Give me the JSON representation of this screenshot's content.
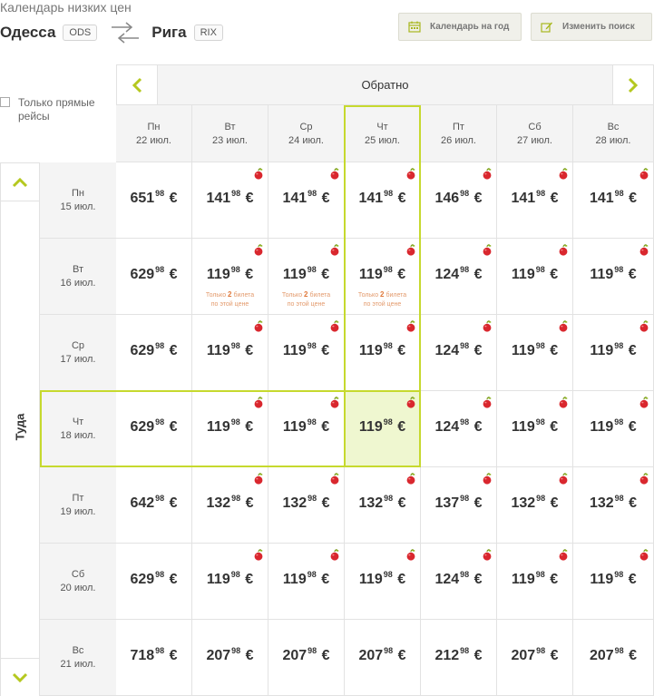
{
  "page_title": "Календарь низких цен",
  "route": {
    "from_city": "Одесса",
    "from_code": "ODS",
    "to_city": "Рига",
    "to_code": "RIX"
  },
  "toolbar": {
    "year_calendar_label": "Календарь на год",
    "change_search_label": "Изменить поиск"
  },
  "filters": {
    "direct_only_label": "Только прямые рейсы",
    "direct_only_checked": false
  },
  "return_nav": {
    "label": "Обратно"
  },
  "depart_nav": {
    "label": "Туда"
  },
  "icons": {
    "prev": "chevron-left-icon",
    "next": "chevron-right-icon",
    "up": "chevron-up-icon",
    "down": "chevron-down-icon",
    "swap": "swap-arrows-icon",
    "calendar": "calendar-icon",
    "edit": "edit-icon",
    "deal": "apple-deal-icon"
  },
  "colors": {
    "accent": "#c6d92e",
    "selected_bg": "#eff7d0",
    "note": "#e0783a",
    "deal": "#d9272e"
  },
  "return_dates": [
    {
      "day": "Пн",
      "date": "22 июл."
    },
    {
      "day": "Вт",
      "date": "23 июл."
    },
    {
      "day": "Ср",
      "date": "24 июл."
    },
    {
      "day": "Чт",
      "date": "25 июл."
    },
    {
      "day": "Пт",
      "date": "26 июл."
    },
    {
      "day": "Сб",
      "date": "27 июл."
    },
    {
      "day": "Вс",
      "date": "28 июл."
    }
  ],
  "depart_dates": [
    {
      "day": "Пн",
      "date": "15 июл."
    },
    {
      "day": "Вт",
      "date": "16 июл."
    },
    {
      "day": "Ср",
      "date": "17 июл."
    },
    {
      "day": "Чт",
      "date": "18 июл."
    },
    {
      "day": "Пт",
      "date": "19 июл."
    },
    {
      "day": "Сб",
      "date": "20 июл."
    },
    {
      "day": "Вс",
      "date": "21 июл."
    }
  ],
  "selected": {
    "depart_index": 3,
    "return_index": 3
  },
  "prices": [
    [
      {
        "main": "651",
        "cents": "98",
        "cur": "€",
        "deal": false
      },
      {
        "main": "141",
        "cents": "98",
        "cur": "€",
        "deal": true
      },
      {
        "main": "141",
        "cents": "98",
        "cur": "€",
        "deal": true
      },
      {
        "main": "141",
        "cents": "98",
        "cur": "€",
        "deal": true
      },
      {
        "main": "146",
        "cents": "98",
        "cur": "€",
        "deal": true
      },
      {
        "main": "141",
        "cents": "98",
        "cur": "€",
        "deal": true
      },
      {
        "main": "141",
        "cents": "98",
        "cur": "€",
        "deal": true
      }
    ],
    [
      {
        "main": "629",
        "cents": "98",
        "cur": "€",
        "deal": false
      },
      {
        "main": "119",
        "cents": "98",
        "cur": "€",
        "deal": true,
        "note": [
          "Только ",
          "2",
          " билета",
          "по этой цене"
        ]
      },
      {
        "main": "119",
        "cents": "98",
        "cur": "€",
        "deal": true,
        "note": [
          "Только ",
          "2",
          " билета",
          "по этой цене"
        ]
      },
      {
        "main": "119",
        "cents": "98",
        "cur": "€",
        "deal": true,
        "note": [
          "Только ",
          "2",
          " билета",
          "по этой цене"
        ]
      },
      {
        "main": "124",
        "cents": "98",
        "cur": "€",
        "deal": true
      },
      {
        "main": "119",
        "cents": "98",
        "cur": "€",
        "deal": true
      },
      {
        "main": "119",
        "cents": "98",
        "cur": "€",
        "deal": true
      }
    ],
    [
      {
        "main": "629",
        "cents": "98",
        "cur": "€",
        "deal": false
      },
      {
        "main": "119",
        "cents": "98",
        "cur": "€",
        "deal": true
      },
      {
        "main": "119",
        "cents": "98",
        "cur": "€",
        "deal": true
      },
      {
        "main": "119",
        "cents": "98",
        "cur": "€",
        "deal": true
      },
      {
        "main": "124",
        "cents": "98",
        "cur": "€",
        "deal": true
      },
      {
        "main": "119",
        "cents": "98",
        "cur": "€",
        "deal": true
      },
      {
        "main": "119",
        "cents": "98",
        "cur": "€",
        "deal": true
      }
    ],
    [
      {
        "main": "629",
        "cents": "98",
        "cur": "€",
        "deal": false
      },
      {
        "main": "119",
        "cents": "98",
        "cur": "€",
        "deal": true
      },
      {
        "main": "119",
        "cents": "98",
        "cur": "€",
        "deal": true
      },
      {
        "main": "119",
        "cents": "98",
        "cur": "€",
        "deal": true
      },
      {
        "main": "124",
        "cents": "98",
        "cur": "€",
        "deal": true
      },
      {
        "main": "119",
        "cents": "98",
        "cur": "€",
        "deal": true
      },
      {
        "main": "119",
        "cents": "98",
        "cur": "€",
        "deal": true
      }
    ],
    [
      {
        "main": "642",
        "cents": "98",
        "cur": "€",
        "deal": false
      },
      {
        "main": "132",
        "cents": "98",
        "cur": "€",
        "deal": true
      },
      {
        "main": "132",
        "cents": "98",
        "cur": "€",
        "deal": true
      },
      {
        "main": "132",
        "cents": "98",
        "cur": "€",
        "deal": true
      },
      {
        "main": "137",
        "cents": "98",
        "cur": "€",
        "deal": true
      },
      {
        "main": "132",
        "cents": "98",
        "cur": "€",
        "deal": true
      },
      {
        "main": "132",
        "cents": "98",
        "cur": "€",
        "deal": true
      }
    ],
    [
      {
        "main": "629",
        "cents": "98",
        "cur": "€",
        "deal": false
      },
      {
        "main": "119",
        "cents": "98",
        "cur": "€",
        "deal": true
      },
      {
        "main": "119",
        "cents": "98",
        "cur": "€",
        "deal": true
      },
      {
        "main": "119",
        "cents": "98",
        "cur": "€",
        "deal": true
      },
      {
        "main": "124",
        "cents": "98",
        "cur": "€",
        "deal": true
      },
      {
        "main": "119",
        "cents": "98",
        "cur": "€",
        "deal": true
      },
      {
        "main": "119",
        "cents": "98",
        "cur": "€",
        "deal": true
      }
    ],
    [
      {
        "main": "718",
        "cents": "98",
        "cur": "€",
        "deal": false
      },
      {
        "main": "207",
        "cents": "98",
        "cur": "€",
        "deal": false
      },
      {
        "main": "207",
        "cents": "98",
        "cur": "€",
        "deal": false
      },
      {
        "main": "207",
        "cents": "98",
        "cur": "€",
        "deal": false
      },
      {
        "main": "212",
        "cents": "98",
        "cur": "€",
        "deal": false
      },
      {
        "main": "207",
        "cents": "98",
        "cur": "€",
        "deal": false
      },
      {
        "main": "207",
        "cents": "98",
        "cur": "€",
        "deal": false
      }
    ]
  ]
}
